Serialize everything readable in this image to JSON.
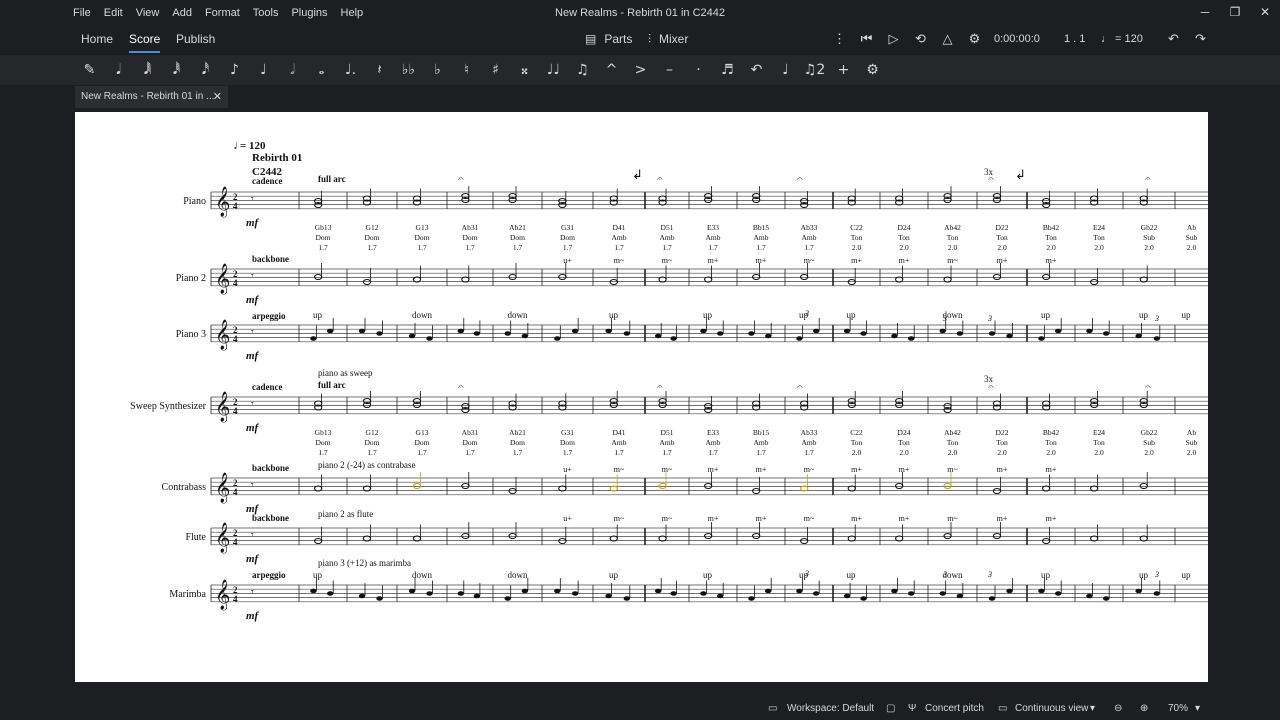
{
  "window": {
    "title": "New Realms - Rebirth 01 in C2442",
    "menu": [
      "File",
      "Edit",
      "View",
      "Add",
      "Format",
      "Tools",
      "Plugins",
      "Help"
    ]
  },
  "tabs": {
    "home": "Home",
    "score": "Score",
    "publish": "Publish"
  },
  "toolbar": {
    "parts": "Parts",
    "mixer": "Mixer",
    "time": "0:00:00:0",
    "position": "1 . 1",
    "tempo": "♩ = 120"
  },
  "note_input": [
    "✎",
    "𝅘𝅥",
    "𝅘𝅥𝅲",
    "𝅘𝅥𝅱",
    "𝅘𝅥𝅰",
    "♪",
    "♩",
    "𝅗𝅥",
    "𝅝",
    "♩.",
    "𝄽",
    "♭♭",
    "♭",
    "♮",
    "♯",
    "𝄪",
    "♩♩",
    "♫",
    "^",
    ">",
    "–",
    "·",
    "♬",
    "↶",
    "♩",
    "♫2",
    "+",
    "⚙"
  ],
  "document_tab": "New Realms - Rebirth 01 in ...",
  "score": {
    "tempo": "= 120",
    "title_line1": "Rebirth 01",
    "title_line2": "C2442",
    "instruments": [
      "Piano",
      "Piano 2",
      "Piano 3",
      "Sweep Synthesizer",
      "Contrabass",
      "Flute",
      "Marimba"
    ],
    "dynamic": "mf",
    "staff_text": {
      "cadence": "cadence",
      "full_arc": "full arc",
      "backbone": "backbone",
      "arpeggio": "arpeggio",
      "piano_as_sweep": "piano as sweep",
      "contrabass_text": "piano 2 (-24) as contrabase",
      "flute_text": "piano 2 as flute",
      "marimba_text": "piano 3 (+12) as marimba",
      "repeat": "3x",
      "triplet": "3"
    },
    "chords": [
      {
        "name": "Gb13",
        "func": "Dom",
        "val": "1.7",
        "ten": "",
        "arp": "up"
      },
      {
        "name": "G12",
        "func": "Dom",
        "val": "1.7",
        "ten": "",
        "arp": ""
      },
      {
        "name": "G13",
        "func": "Dom",
        "val": "1.7",
        "ten": "",
        "arp": "down"
      },
      {
        "name": "Ab31",
        "func": "Dom",
        "val": "1.7",
        "ten": "",
        "arp": ""
      },
      {
        "name": "Ab21",
        "func": "Dom",
        "val": "1.7",
        "ten": "",
        "arp": "down"
      },
      {
        "name": "G31",
        "func": "Dom",
        "val": "1.7",
        "ten": "u+",
        "arp": ""
      },
      {
        "name": "D41",
        "func": "Amb",
        "val": "1.7",
        "ten": "m~",
        "arp": "up"
      },
      {
        "name": "D51",
        "func": "Amb",
        "val": "1.7",
        "ten": "m~",
        "arp": ""
      },
      {
        "name": "E33",
        "func": "Amb",
        "val": "1.7",
        "ten": "m+",
        "arp": "up"
      },
      {
        "name": "Bb15",
        "func": "Amb",
        "val": "1.7",
        "ten": "m+",
        "arp": ""
      },
      {
        "name": "Ab33",
        "func": "Amb",
        "val": "1.7",
        "ten": "m~",
        "arp": "up"
      },
      {
        "name": "C22",
        "func": "Ton",
        "val": "2.0",
        "ten": "m+",
        "arp": "up"
      },
      {
        "name": "D24",
        "func": "Ton",
        "val": "2.0",
        "ten": "m+",
        "arp": ""
      },
      {
        "name": "Ab42",
        "func": "Ton",
        "val": "2.0",
        "ten": "m~",
        "arp": "down"
      },
      {
        "name": "D22",
        "func": "Ton",
        "val": "2.0",
        "ten": "m+",
        "arp": ""
      },
      {
        "name": "Bb42",
        "func": "Ton",
        "val": "2.0",
        "ten": "m+",
        "arp": "up"
      },
      {
        "name": "E24",
        "func": "Ton",
        "val": "2.0",
        "ten": "",
        "arp": ""
      },
      {
        "name": "Gb22",
        "func": "Sub",
        "val": "2.0",
        "ten": "",
        "arp": "up"
      },
      {
        "name": "Ab",
        "func": "Sub",
        "val": "2.0",
        "ten": "",
        "arp": "up"
      }
    ]
  },
  "status": {
    "workspace": "Workspace: Default",
    "concert_pitch": "Concert pitch",
    "view_mode": "Continuous view",
    "zoom": "70%"
  },
  "colors": {
    "accent": "#4a8fd9",
    "playback_marker": "#c2218e",
    "muted_note": "#c8a200"
  }
}
